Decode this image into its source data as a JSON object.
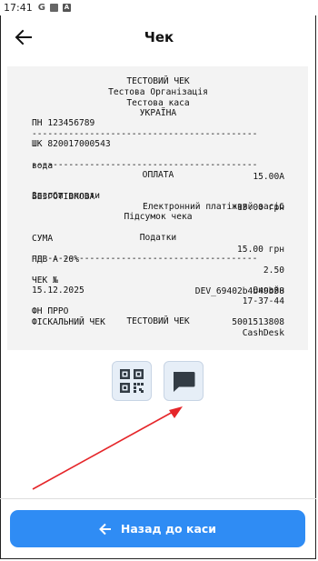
{
  "status_bar": {
    "time": "17:41",
    "icons": [
      "google-g-icon",
      "notification-square-icon",
      "a-icon"
    ]
  },
  "header": {
    "title": "Чек",
    "back_icon": "arrow-left-icon"
  },
  "receipt": {
    "header_lines": [
      "ТЕСТОВИЙ ЧЕК",
      "Тестова Організація",
      "Тестова каса",
      "УКРАЇНА"
    ],
    "tax_id": "ПН 123456789",
    "separator": "-------------------------------------------",
    "barcode": "ШК 820017000543",
    "item_name": "вода",
    "item_price": "15.00А",
    "payment_title": "ОПЛАТА",
    "payment_method": "БЕЗГОТІВКОВА",
    "payment_amount": "15.00 грн",
    "payment_means_label": "Засоби оплати",
    "payment_means_value": "Електронний платіжний засіб",
    "summary_label": "Підсумок чека",
    "sum_label": "СУМА",
    "sum_value": "15.00 грн",
    "taxes_title": "Податки",
    "vat_label": "ПДВ А 20%",
    "vat_value": "2.50",
    "check_no_label": "ЧЕК №",
    "check_no_value": "DEV_69402b4b49b58",
    "date": "15.12.2025",
    "time": "17-37-44",
    "mode": "Онлайн",
    "fn_prro_label": "ФН ПРРО",
    "fn_prro_value": "5001513808",
    "fiscal_label": "ФІСКАЛЬНИЙ ЧЕК",
    "fiscal_value": "CashDesk",
    "footer": "ТЕСТОВИЙ ЧЕК"
  },
  "actions": [
    {
      "name": "qr-code-button",
      "icon": "qr-code-icon"
    },
    {
      "name": "message-button",
      "icon": "chat-bubble-icon"
    }
  ],
  "annotation": {
    "arrow_color": "#e5262a"
  },
  "bottom_button": {
    "label": "Назад до каси",
    "color": "#2f8cf4"
  }
}
